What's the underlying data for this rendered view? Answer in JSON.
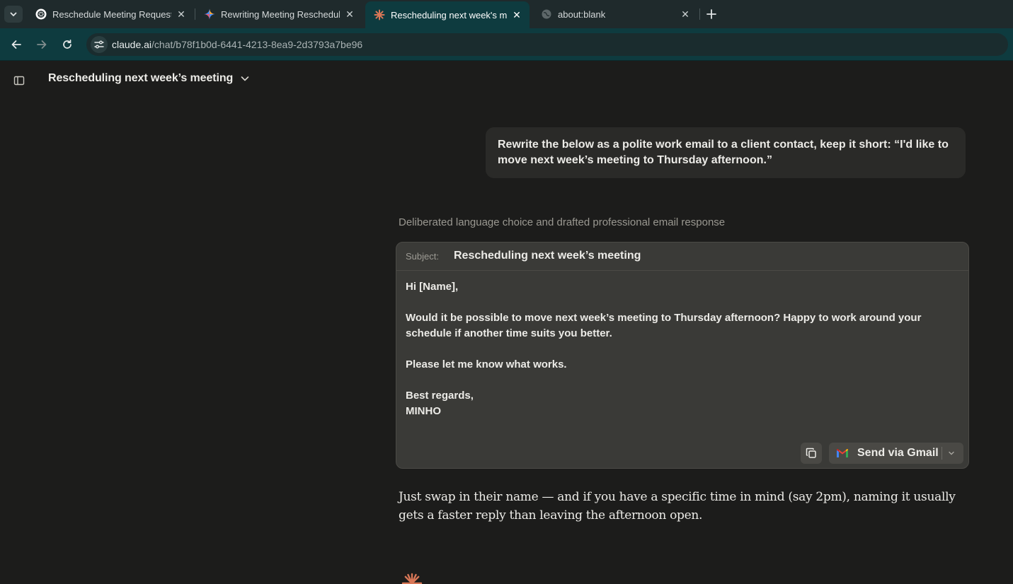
{
  "browser": {
    "tabs": [
      {
        "title": "Reschedule Meeting Request",
        "favicon": "openai-icon",
        "active": false
      },
      {
        "title": "Rewriting Meeting Reschedule",
        "favicon": "gemini-icon",
        "active": false
      },
      {
        "title": "Rescheduling next week's mee",
        "favicon": "claude-icon",
        "active": true
      },
      {
        "title": "about:blank",
        "favicon": "globe-icon",
        "active": false
      }
    ],
    "url_host": "claude.ai",
    "url_path": "/chat/b78f1b0d-6441-4213-8ea9-2d3793a7be96"
  },
  "header": {
    "title": "Rescheduling next week’s meeting"
  },
  "conversation": {
    "user_message": "Rewrite the below as a polite work email to a client contact, keep it short: “I'd like to move next week’s meeting to Thursday afternoon.”",
    "thinking_summary": "Deliberated language choice and drafted professional email response",
    "email": {
      "subject_label": "Subject:",
      "subject": "Rescheduling next week’s meeting",
      "greeting": "Hi [Name],",
      "paragraph1": "Would it be possible to move next week’s meeting to Thursday afternoon? Happy to work around your schedule if another time suits you better.",
      "paragraph2": "Please let me know what works.",
      "signoff": "Best regards,",
      "signature": "MINHO",
      "send_label": "Send via Gmail"
    },
    "reply": "Just swap in their name — and if you have a specific time in mind (say 2pm), naming it usually gets a faster reply than leaving the afternoon open."
  },
  "colors": {
    "accent": "#d97757",
    "chrome": "#0e3b3f",
    "background": "#1c1c1b"
  }
}
